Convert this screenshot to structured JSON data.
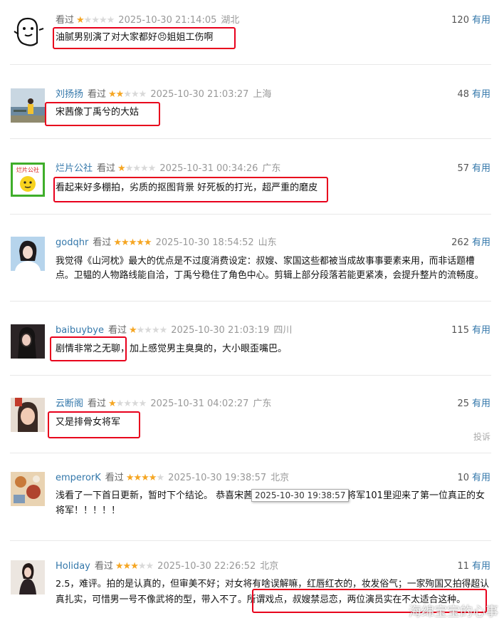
{
  "reviews": [
    {
      "user": "",
      "watched": "看过",
      "stars": 1,
      "date": "2025-10-30 21:14:05",
      "location": "湖北",
      "votes": "120",
      "useful": "有用",
      "text": "油腻男别演了对大家都好😣姐姐工伤啊"
    },
    {
      "user": "刘扬扬",
      "watched": "看过",
      "stars": 2,
      "date": "2025-10-30 21:03:27",
      "location": "上海",
      "votes": "48",
      "useful": "有用",
      "text": "宋茜像丁禹兮的大姑"
    },
    {
      "user": "烂片公社",
      "watched": "看过",
      "stars": 1,
      "date": "2025-10-31 00:34:26",
      "location": "广东",
      "votes": "57",
      "useful": "有用",
      "text": "看起来好多棚拍，劣质的抠图背景 好死板的打光，超严重的磨皮",
      "avatar_text": "烂片公社"
    },
    {
      "user": "godqhr",
      "watched": "看过",
      "stars": 5,
      "date": "2025-10-30 18:54:52",
      "location": "山东",
      "votes": "262",
      "useful": "有用",
      "text": "我觉得《山河枕》最大的优点是不过度消费设定：叔嫂、家国这些都被当成故事事要素来用，而非话题槽点。卫韫的人物路线能自洽，丁禹兮稳住了角色中心。剪辑上部分段落若能更紧凑，会提升整片的流畅度。"
    },
    {
      "user": "baibuybye",
      "watched": "看过",
      "stars": 1,
      "date": "2025-10-30 21:03:19",
      "location": "四川",
      "votes": "115",
      "useful": "有用",
      "text": "剧情非常之无聊，加上感觉男主臭臭的，大小眼歪嘴巴。"
    },
    {
      "user": "云断阁",
      "watched": "看过",
      "stars": 1,
      "date": "2025-10-31 04:02:27",
      "location": "广东",
      "votes": "25",
      "useful": "有用",
      "text": "又是排骨女将军",
      "report": "投诉"
    },
    {
      "user": "emperorK",
      "watched": "看过",
      "stars": 4,
      "date": "2025-10-30 19:38:57",
      "location": "北京",
      "votes": "10",
      "useful": "有用",
      "text_before": "浅看了一下首日更新，暂时下个结论。 恭喜宋茜",
      "text_after": "将军101里迎来了第一位真正的女将军！！！！！"
    },
    {
      "user": "Holiday",
      "watched": "看过",
      "stars": 3,
      "date": "2025-10-30 22:26:52",
      "location": "北京",
      "votes": "11",
      "useful": "有用",
      "text": "2.5，难评。拍的是认真的，但审美不好；对女将有啥误解嘛，红唇红衣的，妆发俗气；一家殉国又拍得超认真扎实，可惜男一号不像武将的型，带入不了。所谓戏点，叔嫂禁忌恋，两位演员实在不太适合这种。"
    }
  ],
  "tooltip": "2025-10-30 19:38:57",
  "watermark": "海绵宝宝的心事",
  "colors": {
    "username": "#3377aa",
    "highlight": "#e8001c",
    "star": "#f5a623"
  }
}
